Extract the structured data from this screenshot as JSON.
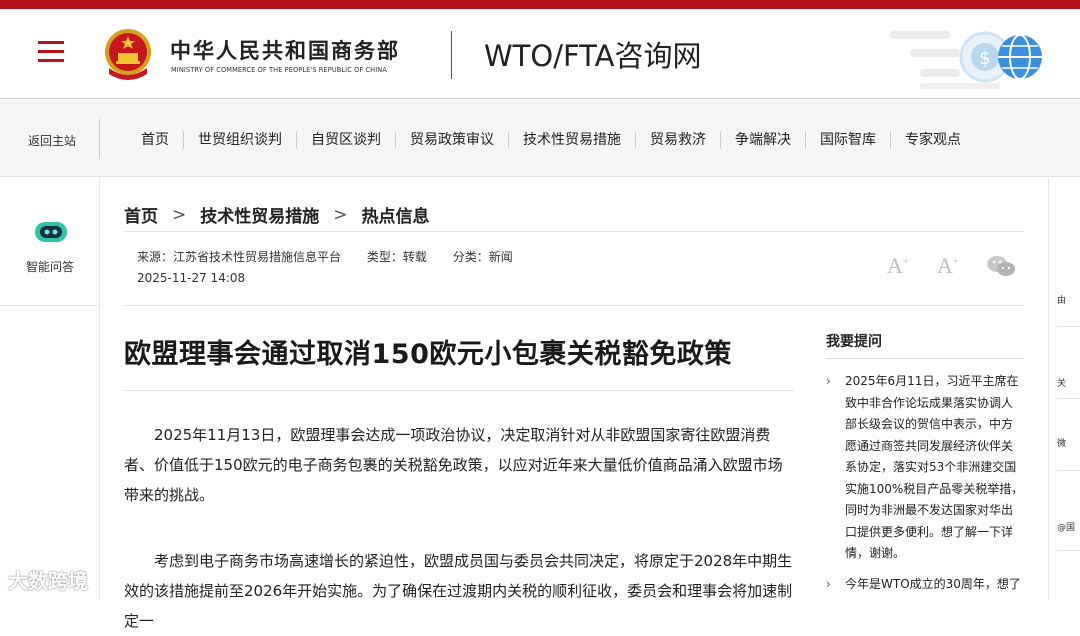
{
  "header": {
    "ministry_cn": "中华人民共和国商务部",
    "ministry_en": "MINISTRY OF COMMERCE OF THE PEOPLE'S REPUBLIC OF CHINA",
    "site_title": "WTO/FTA咨询网",
    "brand_color": "#b5121b",
    "emblem_icon": "national-emblem-icon",
    "deco_icon": "globe-dollar-icon"
  },
  "nav": {
    "back_home": "返回主站",
    "items": [
      "首页",
      "世贸组织谈判",
      "自贸区谈判",
      "贸易政策审议",
      "技术性贸易措施",
      "贸易救济",
      "争端解决",
      "国际智库",
      "专家观点"
    ]
  },
  "left_panel": {
    "ai_label": "智能问答",
    "ai_icon": "chatbot-icon"
  },
  "right_strip": {
    "items": [
      "由",
      "关",
      "微",
      "@国"
    ]
  },
  "breadcrumb": {
    "items": [
      "首页",
      "技术性贸易措施",
      "热点信息"
    ],
    "separator": ">"
  },
  "meta": {
    "source": "来源：江苏省技术性贸易措施信息平台",
    "type": "类型：转载",
    "category": "分类：新闻",
    "date": "2025-11-27 14:08",
    "font_large": "A",
    "font_small": "A",
    "share_icon": "wechat-icon"
  },
  "article": {
    "title": "欧盟理事会通过取消150欧元小包裹关税豁免政策",
    "paragraphs": [
      "2025年11月13日，欧盟理事会达成一项政治协议，决定取消针对从非欧盟国家寄往欧盟消费者、价值低于150欧元的电子商务包裹的关税豁免政策，以应对近年来大量低价值商品涌入欧盟市场带来的挑战。",
      "考虑到电子商务市场高速增长的紧迫性，欧盟成员国与委员会共同决定，将原定于2028年中期生效的该措施提前至2026年开始实施。为了确保在过渡期内关税的顺利征收，委员会和理事会将加速制定一"
    ]
  },
  "sidebar": {
    "heading": "我要提问",
    "items": [
      "2025年6月11日，习近平主席在致中非合作论坛成果落实协调人部长级会议的贺信中表示，中方愿通过商签共同发展经济伙伴关系协定，落实对53个非洲建交国实施100%税目产品零关税举措，同时为非洲最不发达国家对华出口提供更多便利。想了解一下详情，谢谢。",
      "今年是WTO成立的30周年，想了"
    ]
  },
  "watermark": "大数跨境"
}
